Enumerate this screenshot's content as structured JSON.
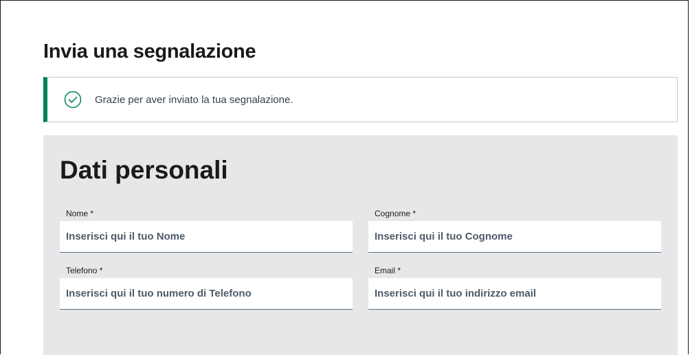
{
  "page": {
    "title": "Invia una segnalazione"
  },
  "alert": {
    "message": "Grazie per aver inviato la tua segnalazione.",
    "icon": "check-circle-icon",
    "accent_color": "#008055"
  },
  "form": {
    "section_title": "Dati personali",
    "fields": {
      "nome": {
        "label": "Nome *",
        "placeholder": "Inserisci qui il tuo Nome",
        "value": ""
      },
      "cognome": {
        "label": "Cognome *",
        "placeholder": "Inserisci qui il tuo Cognome",
        "value": ""
      },
      "telefono": {
        "label": "Telefono *",
        "placeholder": "Inserisci qui il tuo numero di Telefono",
        "value": ""
      },
      "email": {
        "label": "Email *",
        "placeholder": "Inserisci qui il tuo indirizzo email",
        "value": ""
      }
    }
  },
  "colors": {
    "panel_background": "#e6e7e9",
    "success": "#008055",
    "input_text": "#4d5b69"
  }
}
